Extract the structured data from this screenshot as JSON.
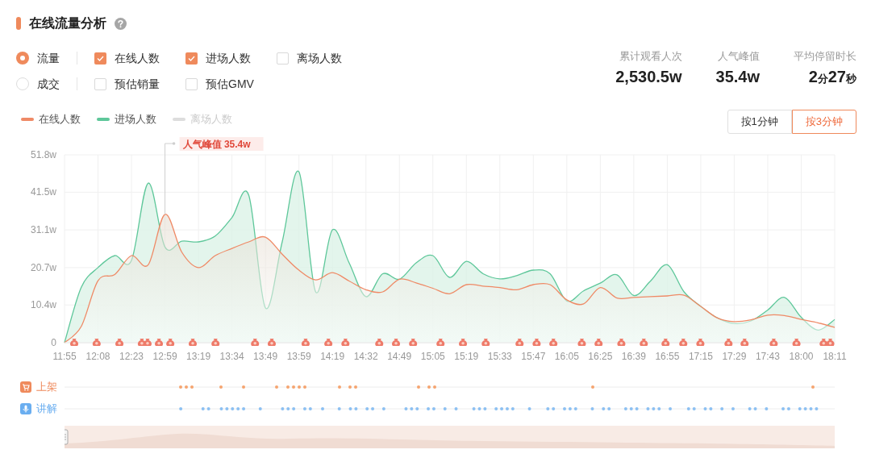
{
  "title": "在线流量分析",
  "modes": [
    {
      "label": "流量",
      "selected": true,
      "metrics": [
        {
          "label": "在线人数",
          "checked": true
        },
        {
          "label": "进场人数",
          "checked": true
        },
        {
          "label": "离场人数",
          "checked": false
        }
      ]
    },
    {
      "label": "成交",
      "selected": false,
      "metrics": [
        {
          "label": "预估销量",
          "checked": false
        },
        {
          "label": "预估GMV",
          "checked": false
        }
      ]
    }
  ],
  "stats": [
    {
      "label": "累计观看人次",
      "value": [
        {
          "text": "2,530.5w",
          "unit": false
        }
      ]
    },
    {
      "label": "人气峰值",
      "value": [
        {
          "text": "35.4w",
          "unit": false
        }
      ]
    },
    {
      "label": "平均停留时长",
      "value": [
        {
          "text": "2",
          "unit": false
        },
        {
          "text": "分",
          "unit": true
        },
        {
          "text": "27",
          "unit": false
        },
        {
          "text": "秒",
          "unit": true
        }
      ]
    }
  ],
  "hidden_series": [
    {
      "label": "离场人数",
      "color": "#dddddd"
    }
  ],
  "intervals": [
    {
      "label": "按1分钟",
      "selected": false
    },
    {
      "label": "按3分钟",
      "selected": true
    }
  ],
  "chart_data": {
    "type": "area",
    "categories": [
      "11:55",
      null,
      "12:08",
      null,
      "12:23",
      null,
      "12:59",
      null,
      "13:19",
      null,
      "13:34",
      null,
      "13:49",
      null,
      "13:59",
      null,
      "14:19",
      null,
      "14:32",
      null,
      "14:49",
      null,
      "15:05",
      null,
      "15:19",
      null,
      "15:33",
      null,
      "15:47",
      null,
      "16:05",
      null,
      "16:25",
      null,
      "16:39",
      null,
      "16:55",
      null,
      "17:15",
      null,
      "17:29",
      null,
      "17:43",
      null,
      "18:00",
      null,
      "18:11"
    ],
    "series": [
      {
        "name": "在线人数",
        "color": "#ef8a66",
        "values": [
          0,
          4.5,
          17.1,
          18.8,
          24,
          21.5,
          35.4,
          25,
          20.7,
          24,
          26,
          27.8,
          29.1,
          24.4,
          20,
          17.3,
          19.3,
          17,
          14.6,
          14,
          17.5,
          16.5,
          15,
          13.5,
          16,
          15.6,
          15.2,
          14.6,
          16,
          16,
          11.8,
          10.7,
          15.2,
          12.3,
          12.5,
          12.7,
          12.9,
          13.1,
          10,
          6.8,
          5.8,
          6.3,
          7.6,
          7.5,
          6.4,
          5.5,
          4.2
        ]
      },
      {
        "name": "进场人数",
        "color": "#5ec79a",
        "values": [
          0,
          15.3,
          20.7,
          24,
          22.7,
          44,
          26.4,
          28,
          27.8,
          29.4,
          34.5,
          40.7,
          9.6,
          27.8,
          47.1,
          14,
          31.1,
          22,
          12.7,
          19,
          17.5,
          22,
          24,
          18,
          22.4,
          19,
          17.6,
          18.5,
          20,
          19,
          11.5,
          14.3,
          16.4,
          18.7,
          13,
          17,
          21.5,
          14,
          10,
          6.8,
          5.3,
          6,
          9,
          12.5,
          7,
          3.5,
          6.4
        ]
      }
    ],
    "ylim": [
      0,
      51.8
    ],
    "yticks": [
      {
        "value": 0,
        "label": "0"
      },
      {
        "value": 10.4,
        "label": "10.4w"
      },
      {
        "value": 20.7,
        "label": "20.7w"
      },
      {
        "value": 31.1,
        "label": "31.1w"
      },
      {
        "value": 41.5,
        "label": "41.5w"
      },
      {
        "value": 51.8,
        "label": "51.8w"
      }
    ],
    "grid": true,
    "annotations": [
      {
        "x": "12:59",
        "y": 35.4,
        "text": "人气峰值 35.4w"
      }
    ]
  },
  "tracks": [
    {
      "label": "上架",
      "kind": "cart",
      "color": "#ef8a5c"
    },
    {
      "label": "讲解",
      "kind": "mic",
      "color": "#6aaef0"
    }
  ],
  "range": {
    "level": 1
  }
}
